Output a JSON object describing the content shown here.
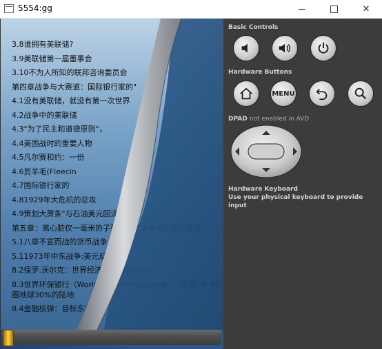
{
  "window": {
    "title": "5554:gg"
  },
  "reader": {
    "lines": [
      "3.8谁拥有美联储?",
      "3.9美联储第一届董事会",
      "3.10不为人所知的联邦咨询委员会",
      "第四章战争与大赛道：国际银行家的\"",
      "4.1没有美联储，就没有第一次世界",
      "4.2战争中的美联储",
      "4.3\"为了民主和道德原则\"，",
      "4.4美国战时的重要人物",
      "4.5凡尔赛和约：一份",
      "4.6剪羊毛(Fleecin",
      "4.7国际银行家的",
      "4.81929年大危机的总攻",
      "4.9策划大萧条\"与石油美元回流",
      "第五章：离心脏仅一毫米的子弹打碎了金本位的最后希望",
      "5.1八章不宣而战的货币战争",
      "5.11973年中东战争:美元反击战",
      "8.2保罗.沃尔克：世界经济\"有控制地解体\"",
      "8.3世界环保银行（WorldConservationBank）：要[奇·书·网]圈地球30%的陆地",
      "8.4金融核弹：目标东京"
    ],
    "scroll_position": 0.0
  },
  "controls": {
    "basic_controls_label": "Basic Controls",
    "basic_buttons": [
      "volume-down",
      "volume-up",
      "power"
    ],
    "hardware_buttons_label": "Hardware Buttons",
    "hardware_buttons": [
      "home",
      "MENU",
      "back",
      "search"
    ],
    "menu_label": "MENU",
    "dpad_label": "DPAD",
    "dpad_note": "not enabled in AVD",
    "keyboard_title": "Hardware Keyboard",
    "keyboard_hint": "Use your physical keyboard to provide input"
  }
}
